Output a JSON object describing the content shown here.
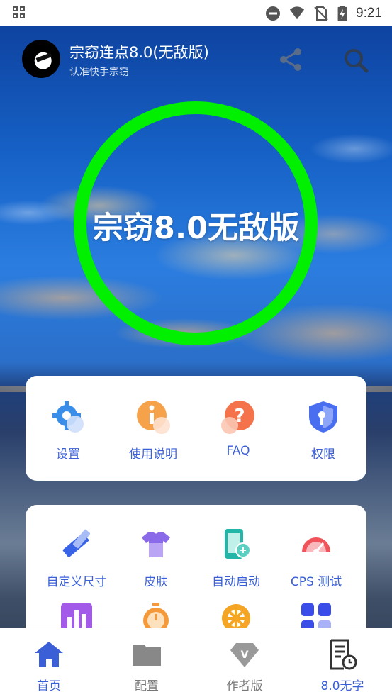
{
  "status_bar": {
    "time": "9:21",
    "icons": [
      "notification-grid-icon",
      "do-not-disturb-icon",
      "wifi-icon",
      "no-sim-icon",
      "battery-charging-icon"
    ]
  },
  "header": {
    "title": "宗窃连点8.0(无敌版)",
    "subtitle": "认准快手宗窃"
  },
  "main": {
    "ring_label": "宗窃8.0无敌版",
    "ring_color": "#00f000"
  },
  "quick_menu": {
    "items": [
      {
        "label": "设置",
        "icon": "gear-icon"
      },
      {
        "label": "使用说明",
        "icon": "info-icon"
      },
      {
        "label": "FAQ",
        "icon": "question-icon"
      },
      {
        "label": "权限",
        "icon": "shield-key-icon"
      }
    ]
  },
  "tools_menu": {
    "items": [
      {
        "label": "自定义尺寸",
        "icon": "ruler-pencil-icon"
      },
      {
        "label": "皮肤",
        "icon": "tshirt-icon"
      },
      {
        "label": "自动启动",
        "icon": "phone-link-icon"
      },
      {
        "label": "CPS 测试",
        "icon": "speedometer-icon"
      },
      {
        "label": "",
        "icon": "bar-chart-icon"
      },
      {
        "label": "",
        "icon": "stopwatch-icon"
      },
      {
        "label": "",
        "icon": "wheel-icon"
      },
      {
        "label": "",
        "icon": "app-grid-icon"
      }
    ]
  },
  "bottom_nav": {
    "tabs": [
      {
        "label": "首页",
        "icon": "home-icon"
      },
      {
        "label": "配置",
        "icon": "folder-icon"
      },
      {
        "label": "作者版",
        "icon": "diamond-v-icon"
      },
      {
        "label": "8.0无字",
        "icon": "document-clock-icon"
      }
    ],
    "active_color": "#3a5fd6",
    "inactive_color": "#777777"
  }
}
